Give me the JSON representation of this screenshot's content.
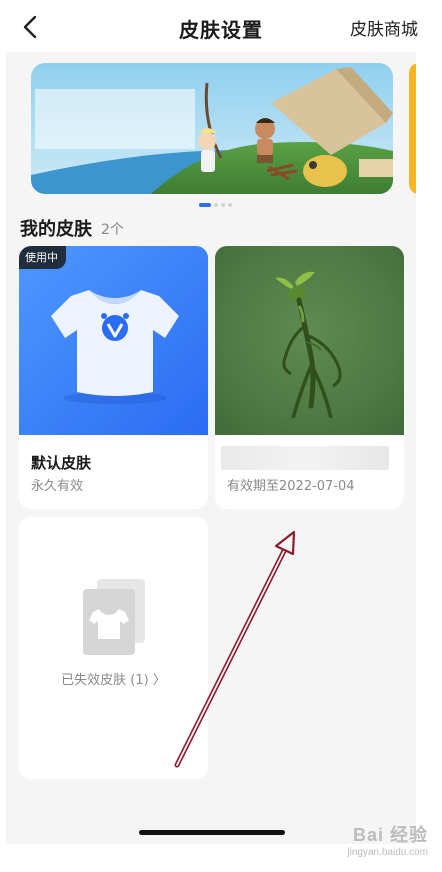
{
  "header": {
    "title": "皮肤设置",
    "store_link": "皮肤商城",
    "back_icon": "chevron-left-icon"
  },
  "banner": {
    "active_index": 0,
    "total": 4
  },
  "my_skins": {
    "title": "我的皮肤",
    "count": "2个",
    "items": [
      {
        "badge": "使用中",
        "name": "默认皮肤",
        "validity": "永久有效",
        "icon": "tshirt-icon"
      },
      {
        "name": "",
        "validity": "有效期至2022-07-04"
      }
    ]
  },
  "expired": {
    "label": "已失效皮肤 (1) 〉",
    "icon": "tshirt-stack-icon"
  },
  "watermark": {
    "main": "Bai 经验",
    "sub": "jingyan.baidu.com"
  },
  "colors": {
    "accent_blue": "#2a6cf3",
    "annotation_arrow": "#8b1a2b"
  }
}
